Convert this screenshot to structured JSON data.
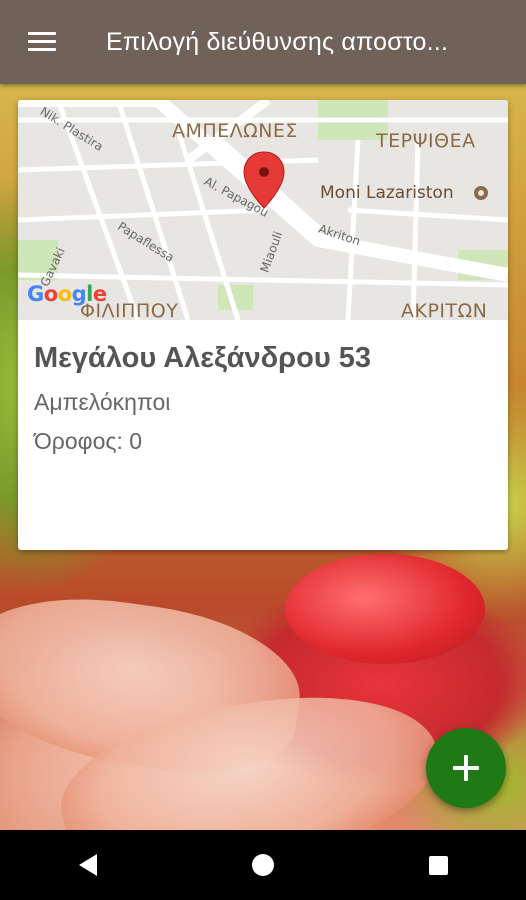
{
  "app_bar": {
    "title": "Επιλογή διεύθυνσης αποστο...",
    "menu_icon": "hamburger-menu-icon"
  },
  "map": {
    "area_labels": [
      "ΑΜΠΕΛΩΝΕΣ",
      "ΤΕΡΨΙΘΕΑ",
      "ΦΙΛΙΠΠΟΥ",
      "ΑΚΡΙΤΩΝ"
    ],
    "streets": [
      "Nik. Plastira",
      "Al. Papagou",
      "Papaflessa",
      "Miaouli",
      "Akriton",
      "Gavaki"
    ],
    "poi": "Moni Lazariston",
    "logo": "Google",
    "marker_color": "#e53935"
  },
  "address": {
    "street": "Μεγάλου Αλεξάνδρου 53",
    "area": "Αμπελόκηποι",
    "floor": "Όροφος: 0"
  },
  "fab": {
    "icon": "plus-icon",
    "color": "#1f7a16"
  },
  "navbar": {
    "back_icon": "back-icon",
    "home_icon": "home-icon",
    "recents_icon": "recents-icon"
  },
  "colors": {
    "app_bar": "#706259"
  }
}
